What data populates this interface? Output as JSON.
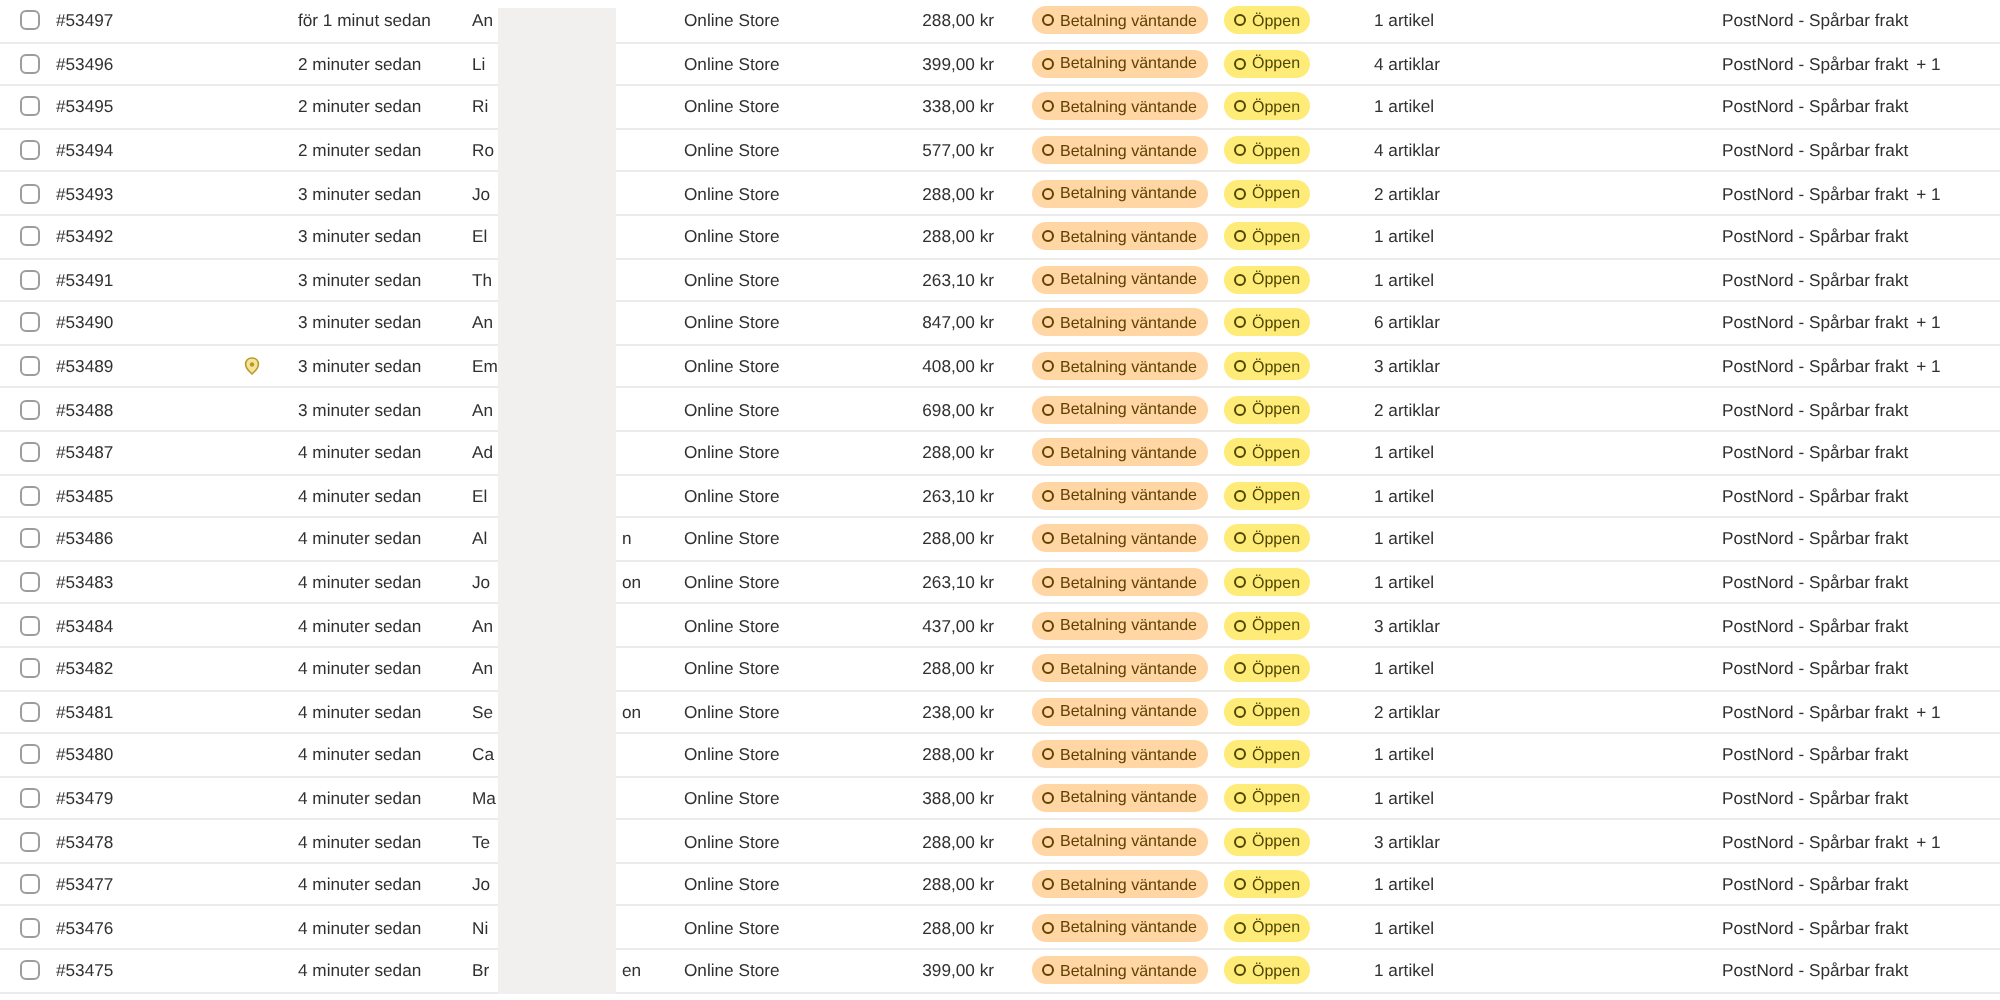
{
  "orders": [
    {
      "checked": false,
      "number": "#53497",
      "note_icon": false,
      "date": "för 1 minut sedan",
      "customer_start": "An",
      "channel": "Online Store",
      "total": "288,00 kr",
      "payment": {
        "label": "Betalning väntande",
        "kind": "pending"
      },
      "fulfillment": {
        "label": "Öppen",
        "kind": "open"
      },
      "items": "1 artikel",
      "delivery": "PostNord - Spårbar frakt"
    },
    {
      "checked": false,
      "number": "#53496",
      "note_icon": false,
      "date": "2 minuter sedan",
      "customer_start": "Li",
      "channel": "Online Store",
      "total": "399,00 kr",
      "payment": {
        "label": "Betalning väntande",
        "kind": "pending"
      },
      "fulfillment": {
        "label": "Öppen",
        "kind": "open"
      },
      "items": "4 artiklar",
      "delivery": "PostNord - Spårbar frakt",
      "delivery_extra": "+ 1"
    },
    {
      "checked": false,
      "number": "#53495",
      "note_icon": false,
      "date": "2 minuter sedan",
      "customer_start": "Ri",
      "channel": "Online Store",
      "total": "338,00 kr",
      "payment": {
        "label": "Betalning väntande",
        "kind": "pending"
      },
      "fulfillment": {
        "label": "Öppen",
        "kind": "open"
      },
      "items": "1 artikel",
      "delivery": "PostNord - Spårbar frakt"
    },
    {
      "checked": false,
      "number": "#53494",
      "note_icon": false,
      "date": "2 minuter sedan",
      "customer_start": "Ro",
      "channel": "Online Store",
      "total": "577,00 kr",
      "payment": {
        "label": "Betalning väntande",
        "kind": "pending"
      },
      "fulfillment": {
        "label": "Öppen",
        "kind": "open"
      },
      "items": "4 artiklar",
      "delivery": "PostNord - Spårbar frakt"
    },
    {
      "checked": false,
      "number": "#53493",
      "note_icon": false,
      "date": "3 minuter sedan",
      "customer_start": "Jo",
      "channel": "Online Store",
      "total": "288,00 kr",
      "payment": {
        "label": "Betalning väntande",
        "kind": "pending"
      },
      "fulfillment": {
        "label": "Öppen",
        "kind": "open"
      },
      "items": "2 artiklar",
      "delivery": "PostNord - Spårbar frakt",
      "delivery_extra": "+ 1"
    },
    {
      "checked": false,
      "number": "#53492",
      "note_icon": false,
      "date": "3 minuter sedan",
      "customer_start": "El",
      "channel": "Online Store",
      "total": "288,00 kr",
      "payment": {
        "label": "Betalning väntande",
        "kind": "pending"
      },
      "fulfillment": {
        "label": "Öppen",
        "kind": "open"
      },
      "items": "1 artikel",
      "delivery": "PostNord - Spårbar frakt"
    },
    {
      "checked": false,
      "number": "#53491",
      "note_icon": false,
      "date": "3 minuter sedan",
      "customer_start": "Th",
      "channel": "Online Store",
      "total": "263,10 kr",
      "payment": {
        "label": "Betalning väntande",
        "kind": "pending"
      },
      "fulfillment": {
        "label": "Öppen",
        "kind": "open"
      },
      "items": "1 artikel",
      "delivery": "PostNord - Spårbar frakt"
    },
    {
      "checked": false,
      "number": "#53490",
      "note_icon": false,
      "date": "3 minuter sedan",
      "customer_start": "An",
      "channel": "Online Store",
      "total": "847,00 kr",
      "payment": {
        "label": "Betalning väntande",
        "kind": "pending"
      },
      "fulfillment": {
        "label": "Öppen",
        "kind": "open"
      },
      "items": "6 artiklar",
      "delivery": "PostNord - Spårbar frakt",
      "delivery_extra": "+ 1"
    },
    {
      "checked": false,
      "number": "#53489",
      "note_icon": true,
      "date": "3 minuter sedan",
      "customer_start": "Em",
      "channel": "Online Store",
      "total": "408,00 kr",
      "payment": {
        "label": "Betalning väntande",
        "kind": "pending"
      },
      "fulfillment": {
        "label": "Öppen",
        "kind": "open"
      },
      "items": "3 artiklar",
      "delivery": "PostNord - Spårbar frakt",
      "delivery_extra": "+ 1"
    },
    {
      "checked": false,
      "number": "#53488",
      "note_icon": false,
      "date": "3 minuter sedan",
      "customer_start": "An",
      "channel": "Online Store",
      "total": "698,00 kr",
      "payment": {
        "label": "Betalning väntande",
        "kind": "pending"
      },
      "fulfillment": {
        "label": "Öppen",
        "kind": "open"
      },
      "items": "2 artiklar",
      "delivery": "PostNord - Spårbar frakt"
    },
    {
      "checked": false,
      "number": "#53487",
      "note_icon": false,
      "date": "4 minuter sedan",
      "customer_start": "Ad",
      "channel": "Online Store",
      "total": "288,00 kr",
      "payment": {
        "label": "Betalning väntande",
        "kind": "pending"
      },
      "fulfillment": {
        "label": "Öppen",
        "kind": "open"
      },
      "items": "1 artikel",
      "delivery": "PostNord - Spårbar frakt"
    },
    {
      "checked": false,
      "number": "#53485",
      "note_icon": false,
      "date": "4 minuter sedan",
      "customer_start": "El",
      "channel": "Online Store",
      "total": "263,10 kr",
      "payment": {
        "label": "Betalning väntande",
        "kind": "pending"
      },
      "fulfillment": {
        "label": "Öppen",
        "kind": "open"
      },
      "items": "1 artikel",
      "delivery": "PostNord - Spårbar frakt"
    },
    {
      "checked": false,
      "number": "#53486",
      "note_icon": false,
      "date": "4 minuter sedan",
      "customer_start": "Al",
      "customer_end": "n",
      "channel": "Online Store",
      "total": "288,00 kr",
      "payment": {
        "label": "Betalning väntande",
        "kind": "pending"
      },
      "fulfillment": {
        "label": "Öppen",
        "kind": "open"
      },
      "items": "1 artikel",
      "delivery": "PostNord - Spårbar frakt"
    },
    {
      "checked": false,
      "number": "#53483",
      "note_icon": false,
      "date": "4 minuter sedan",
      "customer_start": "Jo",
      "customer_end": "on",
      "channel": "Online Store",
      "total": "263,10 kr",
      "payment": {
        "label": "Betalning väntande",
        "kind": "pending"
      },
      "fulfillment": {
        "label": "Öppen",
        "kind": "open"
      },
      "items": "1 artikel",
      "delivery": "PostNord - Spårbar frakt"
    },
    {
      "checked": false,
      "number": "#53484",
      "note_icon": false,
      "date": "4 minuter sedan",
      "customer_start": "An",
      "channel": "Online Store",
      "total": "437,00 kr",
      "payment": {
        "label": "Betalning väntande",
        "kind": "pending"
      },
      "fulfillment": {
        "label": "Öppen",
        "kind": "open"
      },
      "items": "3 artiklar",
      "delivery": "PostNord - Spårbar frakt"
    },
    {
      "checked": false,
      "number": "#53482",
      "note_icon": false,
      "date": "4 minuter sedan",
      "customer_start": "An",
      "channel": "Online Store",
      "total": "288,00 kr",
      "payment": {
        "label": "Betalning väntande",
        "kind": "pending"
      },
      "fulfillment": {
        "label": "Öppen",
        "kind": "open"
      },
      "items": "1 artikel",
      "delivery": "PostNord - Spårbar frakt"
    },
    {
      "checked": false,
      "number": "#53481",
      "note_icon": false,
      "date": "4 minuter sedan",
      "customer_start": "Se",
      "customer_end": "on",
      "channel": "Online Store",
      "total": "238,00 kr",
      "payment": {
        "label": "Betalning väntande",
        "kind": "pending"
      },
      "fulfillment": {
        "label": "Öppen",
        "kind": "open"
      },
      "items": "2 artiklar",
      "delivery": "PostNord - Spårbar frakt",
      "delivery_extra": "+ 1"
    },
    {
      "checked": false,
      "number": "#53480",
      "note_icon": false,
      "date": "4 minuter sedan",
      "customer_start": "Ca",
      "channel": "Online Store",
      "total": "288,00 kr",
      "payment": {
        "label": "Betalning väntande",
        "kind": "pending"
      },
      "fulfillment": {
        "label": "Öppen",
        "kind": "open"
      },
      "items": "1 artikel",
      "delivery": "PostNord - Spårbar frakt"
    },
    {
      "checked": false,
      "number": "#53479",
      "note_icon": false,
      "date": "4 minuter sedan",
      "customer_start": "Ma",
      "channel": "Online Store",
      "total": "388,00 kr",
      "payment": {
        "label": "Betalning väntande",
        "kind": "pending"
      },
      "fulfillment": {
        "label": "Öppen",
        "kind": "open"
      },
      "items": "1 artikel",
      "delivery": "PostNord - Spårbar frakt"
    },
    {
      "checked": false,
      "number": "#53478",
      "note_icon": false,
      "date": "4 minuter sedan",
      "customer_start": "Te",
      "channel": "Online Store",
      "total": "288,00 kr",
      "payment": {
        "label": "Betalning väntande",
        "kind": "pending"
      },
      "fulfillment": {
        "label": "Öppen",
        "kind": "open"
      },
      "items": "3 artiklar",
      "delivery": "PostNord - Spårbar frakt",
      "delivery_extra": "+ 1"
    },
    {
      "checked": false,
      "number": "#53477",
      "note_icon": false,
      "date": "4 minuter sedan",
      "customer_start": "Jo",
      "channel": "Online Store",
      "total": "288,00 kr",
      "payment": {
        "label": "Betalning väntande",
        "kind": "pending"
      },
      "fulfillment": {
        "label": "Öppen",
        "kind": "open"
      },
      "items": "1 artikel",
      "delivery": "PostNord - Spårbar frakt"
    },
    {
      "checked": false,
      "number": "#53476",
      "note_icon": false,
      "date": "4 minuter sedan",
      "customer_start": "Ni",
      "channel": "Online Store",
      "total": "288,00 kr",
      "payment": {
        "label": "Betalning väntande",
        "kind": "pending"
      },
      "fulfillment": {
        "label": "Öppen",
        "kind": "open"
      },
      "items": "1 artikel",
      "delivery": "PostNord - Spårbar frakt"
    },
    {
      "checked": false,
      "number": "#53475",
      "note_icon": false,
      "date": "4 minuter sedan",
      "customer_start": "Br",
      "customer_end": "en",
      "channel": "Online Store",
      "total": "399,00 kr",
      "payment": {
        "label": "Betalning väntande",
        "kind": "pending"
      },
      "fulfillment": {
        "label": "Öppen",
        "kind": "open"
      },
      "items": "1 artikel",
      "delivery": "PostNord - Spårbar frakt"
    }
  ]
}
